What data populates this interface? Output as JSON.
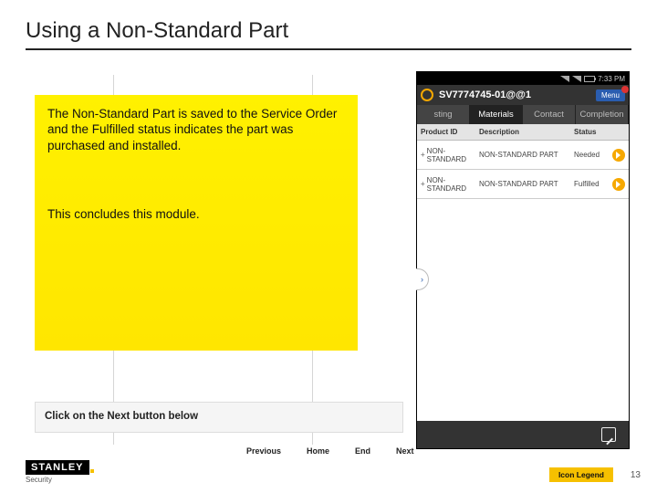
{
  "title": "Using a Non-Standard Part",
  "explain": {
    "p1": "The Non-Standard Part is saved to the Service Order and the Fulfilled status indicates the part was purchased and installed.",
    "p2": "This concludes this module."
  },
  "hint": "Click on the Next button below",
  "nav": {
    "prev": "Previous",
    "home": "Home",
    "end": "End",
    "next": "Next"
  },
  "phone": {
    "time": "7:33 PM",
    "svid": "SV7774745-01@@1",
    "menu": "Menu",
    "tabs": {
      "t1": "sting",
      "t2": "Materials",
      "t3": "Contact",
      "t4": "Completion"
    },
    "headers": {
      "pid": "Product ID",
      "desc": "Description",
      "stat": "Status"
    },
    "rows": [
      {
        "pid": "NON-STANDARD",
        "desc": "NON-STANDARD PART",
        "stat": "Needed"
      },
      {
        "pid": "NON-STANDARD",
        "desc": "NON-STANDARD PART",
        "stat": "Fulfilled"
      }
    ]
  },
  "brand": {
    "name": "STANLEY",
    "sub": "Security"
  },
  "iconLegend": "Icon Legend",
  "page": "13"
}
